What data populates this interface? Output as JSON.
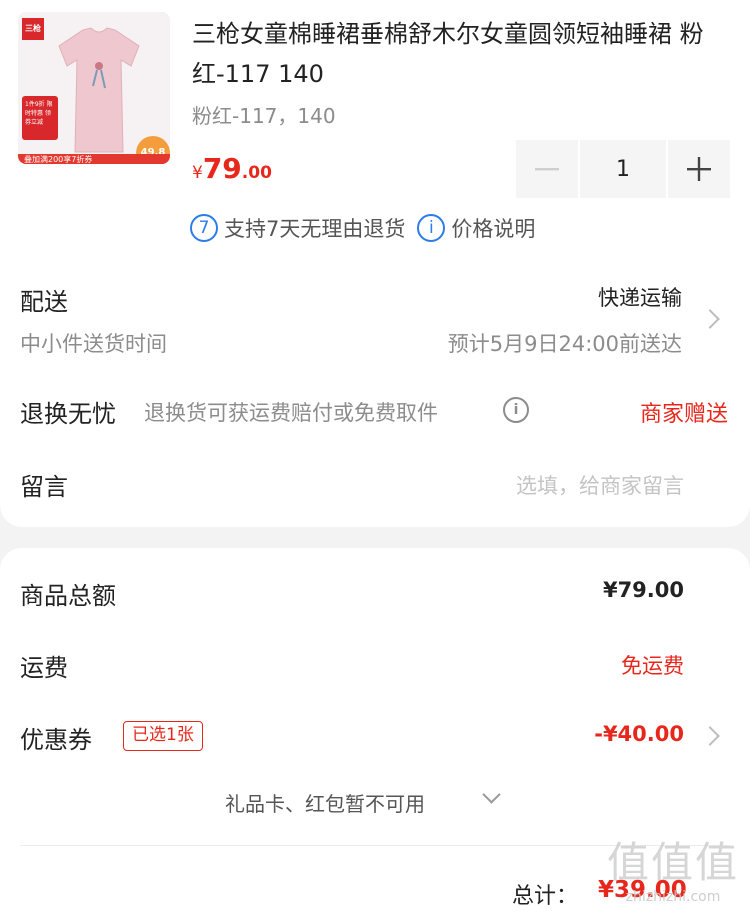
{
  "product": {
    "title": "三枪女童棉睡裙垂棉舒木尔女童圆领短袖睡裙 粉红-117 140",
    "sku": "粉红-117，140",
    "price_currency": "¥",
    "price_int": "79",
    "price_dec": ".00",
    "quantity": "1",
    "thumb": {
      "brand": "三枪",
      "tag": "1件9折 限时特惠 领券立减",
      "price_badge": "49.8",
      "strip": "叠加满200享7折券"
    }
  },
  "policy": {
    "return_icon": "7",
    "return_text": "支持7天无理由退货",
    "price_icon": "i",
    "price_text": "价格说明"
  },
  "delivery": {
    "label": "配送",
    "method": "快递运输",
    "sub_label": "中小件送货时间",
    "estimate": "预计5月9日24:00前送达"
  },
  "return_service": {
    "label": "退换无忧",
    "desc": "退换货可获运费赔付或免费取件",
    "value": "商家赠送"
  },
  "message": {
    "label": "留言",
    "placeholder": "选填，给商家留言"
  },
  "summary": {
    "subtotal_label": "商品总额",
    "subtotal": "¥79.00",
    "shipping_label": "运费",
    "shipping": "免运费",
    "coupon_label": "优惠券",
    "coupon_badge": "已选1张",
    "coupon_value": "-¥40.00",
    "gift_text": "礼品卡、红包暂不可用",
    "total_label": "总计：",
    "total": "¥39.00"
  },
  "watermark": {
    "line1": "值值值",
    "line2": "zhizhizhi.com"
  },
  "colors": {
    "accent_red": "#e8271c",
    "link_blue": "#2b7de9",
    "muted": "#8c8c8c"
  }
}
